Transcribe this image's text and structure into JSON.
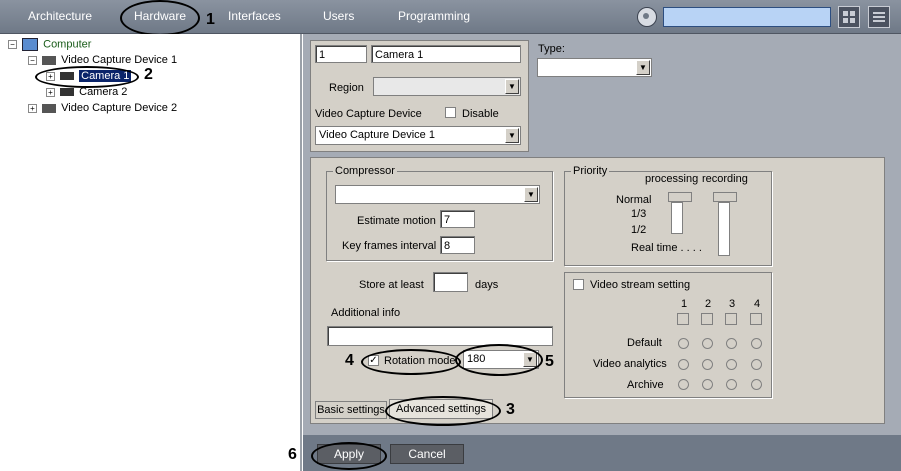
{
  "topbar": {
    "tabs": [
      "Architecture",
      "Hardware",
      "Interfaces",
      "Users",
      "Programming"
    ],
    "search_value": ""
  },
  "tree": {
    "root": "Computer",
    "vcd1": "Video Capture Device 1",
    "cam1": "Camera 1",
    "cam2": "Camera 2",
    "vcd2": "Video Capture Device 2"
  },
  "object": {
    "id": "1",
    "name": "Camera 1",
    "region_label": "Region",
    "region_value": "",
    "vcd_label": "Video Capture Device",
    "disable_label": "Disable",
    "vcd_value": "Video Capture Device 1",
    "type_label": "Type:",
    "type_value": ""
  },
  "compressor": {
    "title": "Compressor",
    "value": "",
    "estimate_label": "Estimate motion",
    "estimate_value": "7",
    "keyframes_label": "Key frames interval",
    "keyframes_value": "8"
  },
  "priority": {
    "title": "Priority",
    "col_processing": "processing",
    "col_recording": "recording",
    "levels": [
      "Normal",
      "1/3",
      "1/2",
      "Real time . . . ."
    ]
  },
  "store": {
    "label": "Store at least",
    "value": "",
    "unit": "days"
  },
  "additional": {
    "label": "Additional info",
    "value": ""
  },
  "rotation": {
    "label": "Rotation mode",
    "checked": true,
    "value": "180"
  },
  "stream": {
    "label": "Video stream setting",
    "cols": [
      "1",
      "2",
      "3",
      "4"
    ],
    "rows": [
      "Default",
      "Video analytics",
      "Archive"
    ]
  },
  "subtabs": {
    "basic": "Basic settings",
    "advanced": "Advanced settings"
  },
  "buttons": {
    "apply": "Apply",
    "cancel": "Cancel"
  },
  "annotations": [
    "1",
    "2",
    "3",
    "4",
    "5",
    "6"
  ]
}
